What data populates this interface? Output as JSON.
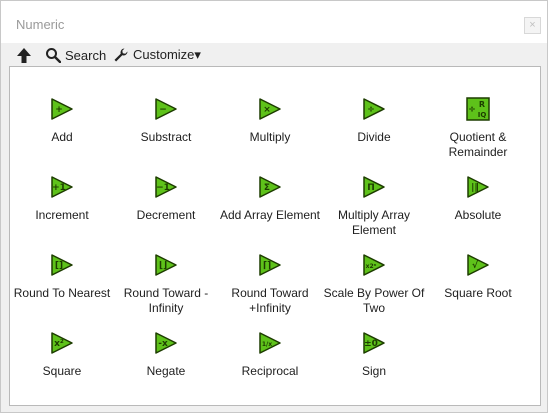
{
  "window": {
    "title": "Numeric",
    "close_label": "×"
  },
  "toolbar": {
    "up_icon": "up-arrow-icon",
    "search_label": "Search",
    "customize_label": "Customize▾"
  },
  "colors": {
    "icon_green": "#5ec21a",
    "icon_dark": "#1d3d00"
  },
  "palette": {
    "items": [
      {
        "label": "Add",
        "glyph": "+"
      },
      {
        "label": "Substract",
        "glyph": "−"
      },
      {
        "label": "Multiply",
        "glyph": "×"
      },
      {
        "label": "Divide",
        "glyph": "÷"
      },
      {
        "label": "Quotient & Remainder",
        "glyph": "R IQ"
      },
      {
        "label": "Increment",
        "glyph": "+1"
      },
      {
        "label": "Decrement",
        "glyph": "−1"
      },
      {
        "label": "Add Array Element",
        "glyph": "Σ"
      },
      {
        "label": "Multiply Array Element",
        "glyph": "Π"
      },
      {
        "label": "Absolute",
        "glyph": "|‖"
      },
      {
        "label": "Round To Nearest",
        "glyph": "[]"
      },
      {
        "label": "Round Toward -Infinity",
        "glyph": "⌊⌋"
      },
      {
        "label": "Round Toward +Infinity",
        "glyph": "⌈⌉"
      },
      {
        "label": "Scale By Power Of Two",
        "glyph": "x2ⁿ"
      },
      {
        "label": "Square Root",
        "glyph": "√"
      },
      {
        "label": "Square",
        "glyph": "x²"
      },
      {
        "label": "Negate",
        "glyph": "-x"
      },
      {
        "label": "Reciprocal",
        "glyph": "1/x"
      },
      {
        "label": "Sign",
        "glyph": "±0"
      }
    ]
  }
}
